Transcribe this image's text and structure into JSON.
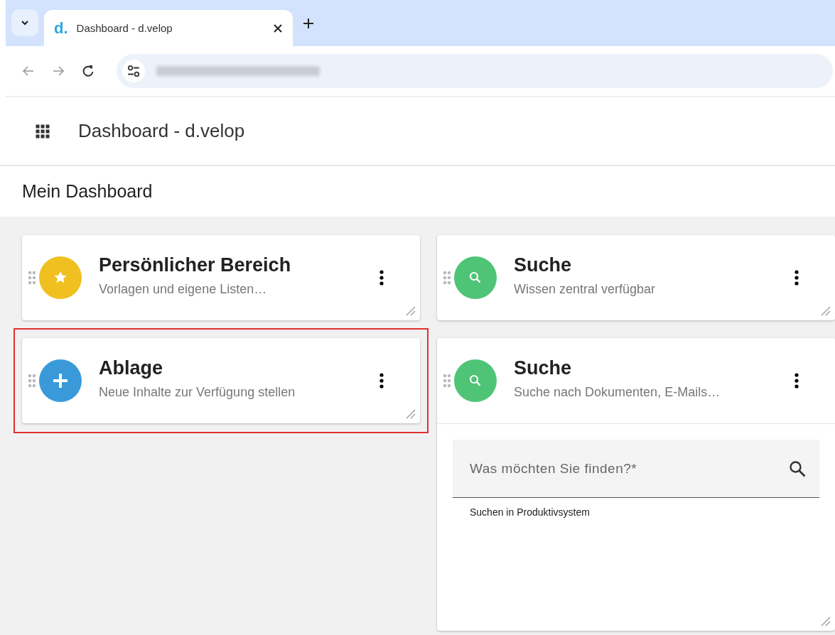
{
  "browser": {
    "tab_title": "Dashboard - d.velop",
    "tab_logo": "d."
  },
  "app_header": {
    "title": "Dashboard - d.velop"
  },
  "page_title": "Mein Dashboard",
  "columns": [
    {
      "tiles": [
        {
          "kind": "star",
          "color": "#f0c020",
          "title": "Persönlicher Bereich",
          "subtitle": "Vorlagen und eigene Listen…",
          "highlighted": false
        },
        {
          "kind": "plus",
          "color": "#3a9ad9",
          "title": "Ablage",
          "subtitle": "Neue Inhalte zur Verfügung stellen",
          "highlighted": true
        }
      ]
    },
    {
      "tiles": [
        {
          "kind": "search",
          "color": "#4fc476",
          "title": "Suche",
          "subtitle": "Wissen zentral verfügbar",
          "highlighted": false
        },
        {
          "kind": "search",
          "color": "#4fc476",
          "title": "Suche",
          "subtitle": "Suche nach Dokumenten, E-Mails…",
          "highlighted": false,
          "search": {
            "placeholder": "Was möchten Sie finden?*",
            "hint": "Suchen in Produktivsystem"
          }
        }
      ]
    }
  ]
}
